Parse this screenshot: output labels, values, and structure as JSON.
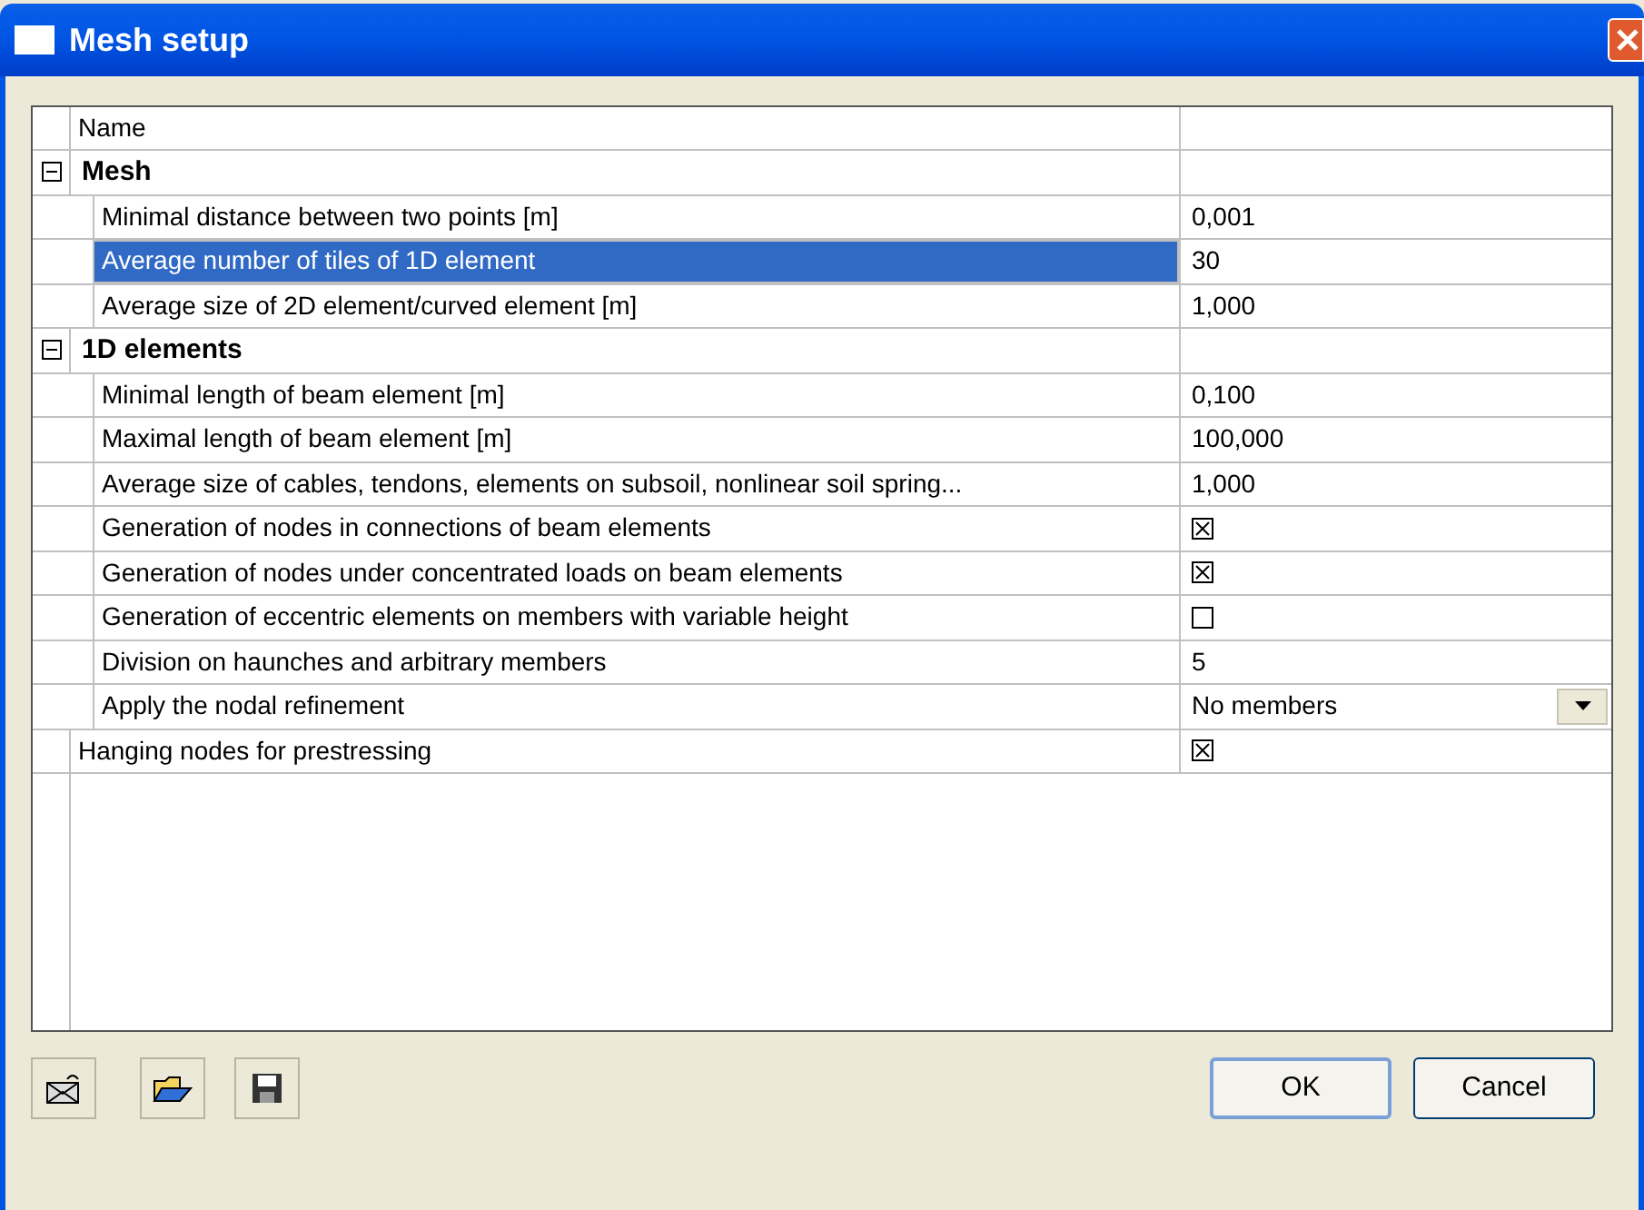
{
  "window": {
    "title": "Mesh setup"
  },
  "grid": {
    "columns": [
      "Name"
    ],
    "groups": [
      {
        "label": "Mesh",
        "expanded": true,
        "properties": [
          {
            "kind": "text",
            "label": "Minimal distance between two points [m]",
            "value": "0,001",
            "selected": false
          },
          {
            "kind": "text",
            "label": "Average number of tiles of 1D element",
            "value": "30",
            "selected": true
          },
          {
            "kind": "text",
            "label": "Average size of 2D element/curved element [m]",
            "value": "1,000",
            "selected": false
          }
        ]
      },
      {
        "label": "1D elements",
        "expanded": true,
        "properties": [
          {
            "kind": "text",
            "label": "Minimal length of beam element [m]",
            "value": "0,100",
            "selected": false
          },
          {
            "kind": "text",
            "label": "Maximal length of beam element [m]",
            "value": "100,000",
            "selected": false
          },
          {
            "kind": "text",
            "label": "Average size of cables, tendons, elements on subsoil, nonlinear soil spring...",
            "value": "1,000",
            "selected": false
          },
          {
            "kind": "checkbox",
            "label": "Generation of nodes in connections of beam elements",
            "checked": true,
            "selected": false
          },
          {
            "kind": "checkbox",
            "label": "Generation of nodes under concentrated loads on beam elements",
            "checked": true,
            "selected": false
          },
          {
            "kind": "checkbox",
            "label": "Generation of eccentric elements on members with variable height",
            "checked": false,
            "selected": false
          },
          {
            "kind": "text",
            "label": "Division on haunches and arbitrary members",
            "value": "5",
            "selected": false
          },
          {
            "kind": "dropdown",
            "label": "Apply the nodal refinement",
            "value": "No members",
            "selected": false
          }
        ]
      }
    ],
    "properties": [
      {
        "kind": "checkbox",
        "label": "Hanging nodes for prestressing",
        "checked": true,
        "selected": false
      }
    ]
  },
  "buttons": [
    "OK",
    "Cancel"
  ]
}
